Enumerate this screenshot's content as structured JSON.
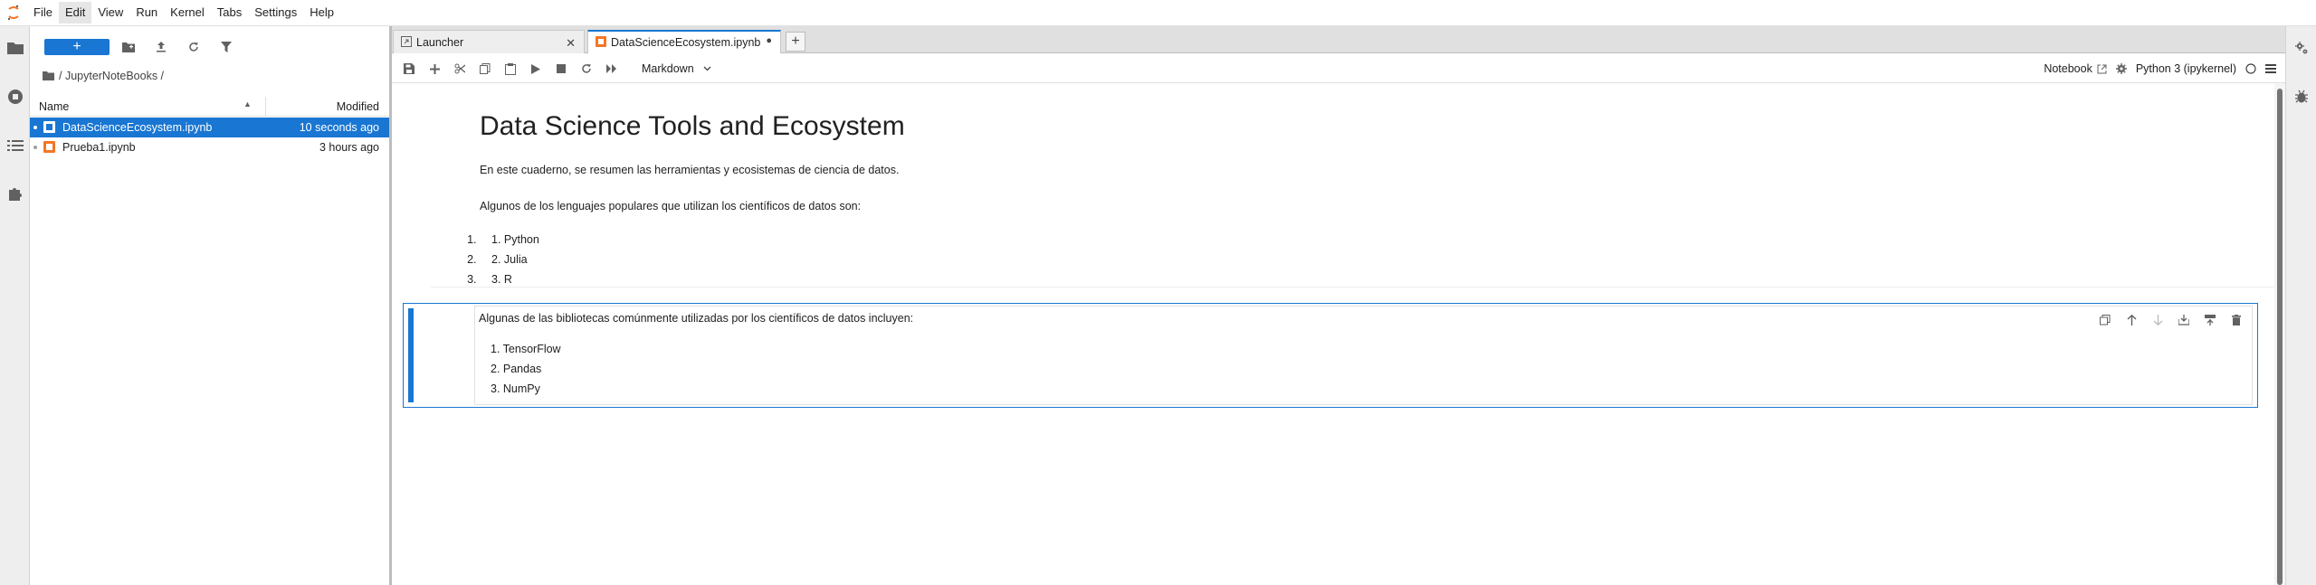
{
  "menu": [
    "File",
    "Edit",
    "View",
    "Run",
    "Kernel",
    "Tabs",
    "Settings",
    "Help"
  ],
  "menu_active": "Edit",
  "filebrowser": {
    "new_label": "+",
    "breadcrumb": "/ JupyterNoteBooks /",
    "col_name": "Name",
    "col_modified": "Modified",
    "sort_glyph": "▲",
    "files": [
      {
        "name": "DataScienceEcosystem.ipynb",
        "modified": "10 seconds ago",
        "selected": true
      },
      {
        "name": "Prueba1.ipynb",
        "modified": "3 hours ago",
        "selected": false
      }
    ]
  },
  "tabs": [
    {
      "label": "Launcher",
      "close": "✕"
    },
    {
      "label": "DataScienceEcosystem.ipynb",
      "close": "●"
    }
  ],
  "tab_add": "+",
  "toolbar": {
    "cell_type": "Markdown",
    "notebook_label": "Notebook",
    "kernel_label": "Python 3 (ipykernel)"
  },
  "notebook": {
    "title": "Data Science Tools and Ecosystem",
    "intro": "En este cuaderno, se resumen las herramientas y ecosistemas de ciencia de datos.",
    "languages_intro": "Algunos de los lenguajes populares que utilizan los científicos de datos son:",
    "languages": [
      "1. Python",
      "2. Julia",
      "3. R"
    ],
    "libraries_intro": "Algunas de las bibliotecas comúnmente utilizadas por los científicos de datos incluyen:",
    "libraries": [
      "1. TensorFlow",
      "2. Pandas",
      "3. NumPy"
    ]
  },
  "colors": {
    "accent": "#1976d2",
    "orange": "#f37726"
  }
}
